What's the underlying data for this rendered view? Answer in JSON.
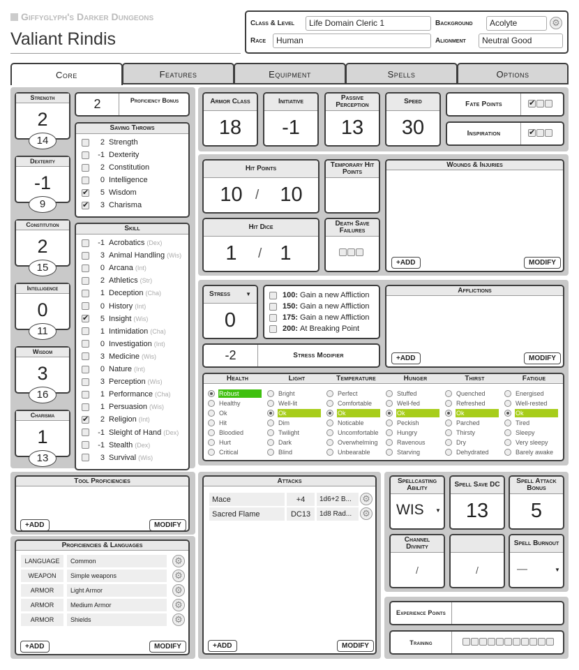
{
  "header": {
    "brand": "Giffyglyph's Darker Dungeons",
    "character_name": "Valiant Rindis",
    "class_level_label": "Class & Level",
    "class_level": "Life Domain Cleric 1",
    "background_label": "Background",
    "background": "Acolyte",
    "race_label": "Race",
    "race": "Human",
    "alignment_label": "Alignment",
    "alignment": "Neutral Good"
  },
  "tabs": [
    "Core",
    "Features",
    "Equipment",
    "Spells",
    "Options"
  ],
  "abilities": [
    {
      "name": "Strength",
      "mod": "2",
      "score": "14"
    },
    {
      "name": "Dexterity",
      "mod": "-1",
      "score": "9"
    },
    {
      "name": "Constitution",
      "mod": "2",
      "score": "15"
    },
    {
      "name": "Intelligence",
      "mod": "0",
      "score": "11"
    },
    {
      "name": "Wisdom",
      "mod": "3",
      "score": "16"
    },
    {
      "name": "Charisma",
      "mod": "1",
      "score": "13"
    }
  ],
  "proficiency": {
    "value": "2",
    "label": "Proficiency Bonus"
  },
  "saving_throws": {
    "title": "Saving Throws",
    "items": [
      {
        "val": "2",
        "name": "Strength",
        "checked": false
      },
      {
        "val": "-1",
        "name": "Dexterity",
        "checked": false
      },
      {
        "val": "2",
        "name": "Constitution",
        "checked": false
      },
      {
        "val": "0",
        "name": "Intelligence",
        "checked": false
      },
      {
        "val": "5",
        "name": "Wisdom",
        "checked": true
      },
      {
        "val": "3",
        "name": "Charisma",
        "checked": true
      }
    ]
  },
  "skills": {
    "title": "Skill",
    "items": [
      {
        "val": "-1",
        "name": "Acrobatics",
        "ab": "(Dex)",
        "checked": false
      },
      {
        "val": "3",
        "name": "Animal Handling",
        "ab": "(Wis)",
        "checked": false
      },
      {
        "val": "0",
        "name": "Arcana",
        "ab": "(Int)",
        "checked": false
      },
      {
        "val": "2",
        "name": "Athletics",
        "ab": "(Str)",
        "checked": false
      },
      {
        "val": "1",
        "name": "Deception",
        "ab": "(Cha)",
        "checked": false
      },
      {
        "val": "0",
        "name": "History",
        "ab": "(Int)",
        "checked": false
      },
      {
        "val": "5",
        "name": "Insight",
        "ab": "(Wis)",
        "checked": true
      },
      {
        "val": "1",
        "name": "Intimidation",
        "ab": "(Cha)",
        "checked": false
      },
      {
        "val": "0",
        "name": "Investigation",
        "ab": "(Int)",
        "checked": false
      },
      {
        "val": "3",
        "name": "Medicine",
        "ab": "(Wis)",
        "checked": false
      },
      {
        "val": "0",
        "name": "Nature",
        "ab": "(Int)",
        "checked": false
      },
      {
        "val": "3",
        "name": "Perception",
        "ab": "(Wis)",
        "checked": false
      },
      {
        "val": "1",
        "name": "Performance",
        "ab": "(Cha)",
        "checked": false
      },
      {
        "val": "1",
        "name": "Persuasion",
        "ab": "(Wis)",
        "checked": false
      },
      {
        "val": "2",
        "name": "Religion",
        "ab": "(Int)",
        "checked": true
      },
      {
        "val": "-1",
        "name": "Sleight of Hand",
        "ab": "(Dex)",
        "checked": false
      },
      {
        "val": "-1",
        "name": "Stealth",
        "ab": "(Dex)",
        "checked": false
      },
      {
        "val": "3",
        "name": "Survival",
        "ab": "(Wis)",
        "checked": false
      }
    ]
  },
  "tools": {
    "title": "Tool Proficiencies",
    "add": "+ADD",
    "modify": "MODIFY"
  },
  "proficiencies": {
    "title": "Proficiencies & Languages",
    "add": "+ADD",
    "modify": "MODIFY",
    "items": [
      {
        "type": "LANGUAGE",
        "value": "Common"
      },
      {
        "type": "WEAPON",
        "value": "Simple weapons"
      },
      {
        "type": "ARMOR",
        "value": "Light Armor"
      },
      {
        "type": "ARMOR",
        "value": "Medium Armor"
      },
      {
        "type": "ARMOR",
        "value": "Shields"
      }
    ]
  },
  "combat": {
    "ac_label": "Armor Class",
    "ac": "18",
    "init_label": "Initiative",
    "init": "-1",
    "pp_label": "Passive Perception",
    "pp": "13",
    "speed_label": "Speed",
    "speed": "30",
    "fate_label": "Fate Points",
    "insp_label": "Inspiration"
  },
  "hp": {
    "label": "Hit Points",
    "current": "10",
    "max": "10",
    "sep": "/",
    "temp_label": "Temporary Hit Points",
    "dice_label": "Hit Dice",
    "dice_current": "1",
    "dice_max": "1",
    "death_label": "Death Save Failures"
  },
  "wounds": {
    "title": "Wounds & Injuries",
    "add": "+ADD",
    "modify": "MODIFY"
  },
  "stress": {
    "label": "Stress",
    "value": "0",
    "modifier": "-2",
    "modifier_label": "Stress Modifier",
    "thresholds": [
      {
        "n": "100:",
        "t": "Gain a new Affliction"
      },
      {
        "n": "150:",
        "t": "Gain a new Affliction"
      },
      {
        "n": "175:",
        "t": "Gain a new Affliction"
      },
      {
        "n": "200:",
        "t": "At Breaking Point"
      }
    ]
  },
  "afflictions": {
    "title": "Afflictions",
    "add": "+ADD",
    "modify": "MODIFY"
  },
  "conditions": [
    {
      "title": "Health",
      "options": [
        "Robust",
        "Healthy",
        "Ok",
        "Hit",
        "Bloodied",
        "Hurt",
        "Critical"
      ],
      "selected": 0
    },
    {
      "title": "Light",
      "options": [
        "Bright",
        "Well-lit",
        "Ok",
        "Dim",
        "Twilight",
        "Dark",
        "Blind"
      ],
      "selected": 2
    },
    {
      "title": "Temperature",
      "options": [
        "Perfect",
        "Comfortable",
        "Ok",
        "Noticable",
        "Uncomfortable",
        "Overwhelming",
        "Unbearable"
      ],
      "selected": 2
    },
    {
      "title": "Hunger",
      "options": [
        "Stuffed",
        "Well-fed",
        "Ok",
        "Peckish",
        "Hungry",
        "Ravenous",
        "Starving"
      ],
      "selected": 2
    },
    {
      "title": "Thirst",
      "options": [
        "Quenched",
        "Refreshed",
        "Ok",
        "Parched",
        "Thirsty",
        "Dry",
        "Dehydrated"
      ],
      "selected": 2
    },
    {
      "title": "Fatigue",
      "options": [
        "Energised",
        "Well-rested",
        "Ok",
        "Tired",
        "Sleepy",
        "Very sleepy",
        "Barely awake"
      ],
      "selected": 2
    }
  ],
  "attacks": {
    "title": "Attacks",
    "add": "+ADD",
    "modify": "MODIFY",
    "items": [
      {
        "name": "Mace",
        "bonus": "+4",
        "damage": "1d6+2 B..."
      },
      {
        "name": "Sacred Flame",
        "bonus": "DC13",
        "damage": "1d8 Rad..."
      }
    ]
  },
  "spellcasting": {
    "ability_label": "Spellcasting Ability",
    "ability": "WIS",
    "dc_label": "Spell Save DC",
    "dc": "13",
    "attack_label": "Spell Attack Bonus",
    "attack": "5",
    "channel_label": "Channel Divinity",
    "channel": "/",
    "blank": "/",
    "burnout_label": "Spell Burnout",
    "burnout": "—"
  },
  "xp": {
    "label": "Experience Points",
    "training_label": "Training"
  },
  "colors": {
    "robust": "#3fc00f",
    "ok": "#a7cd1a",
    "panel": "#c9c9c9"
  }
}
